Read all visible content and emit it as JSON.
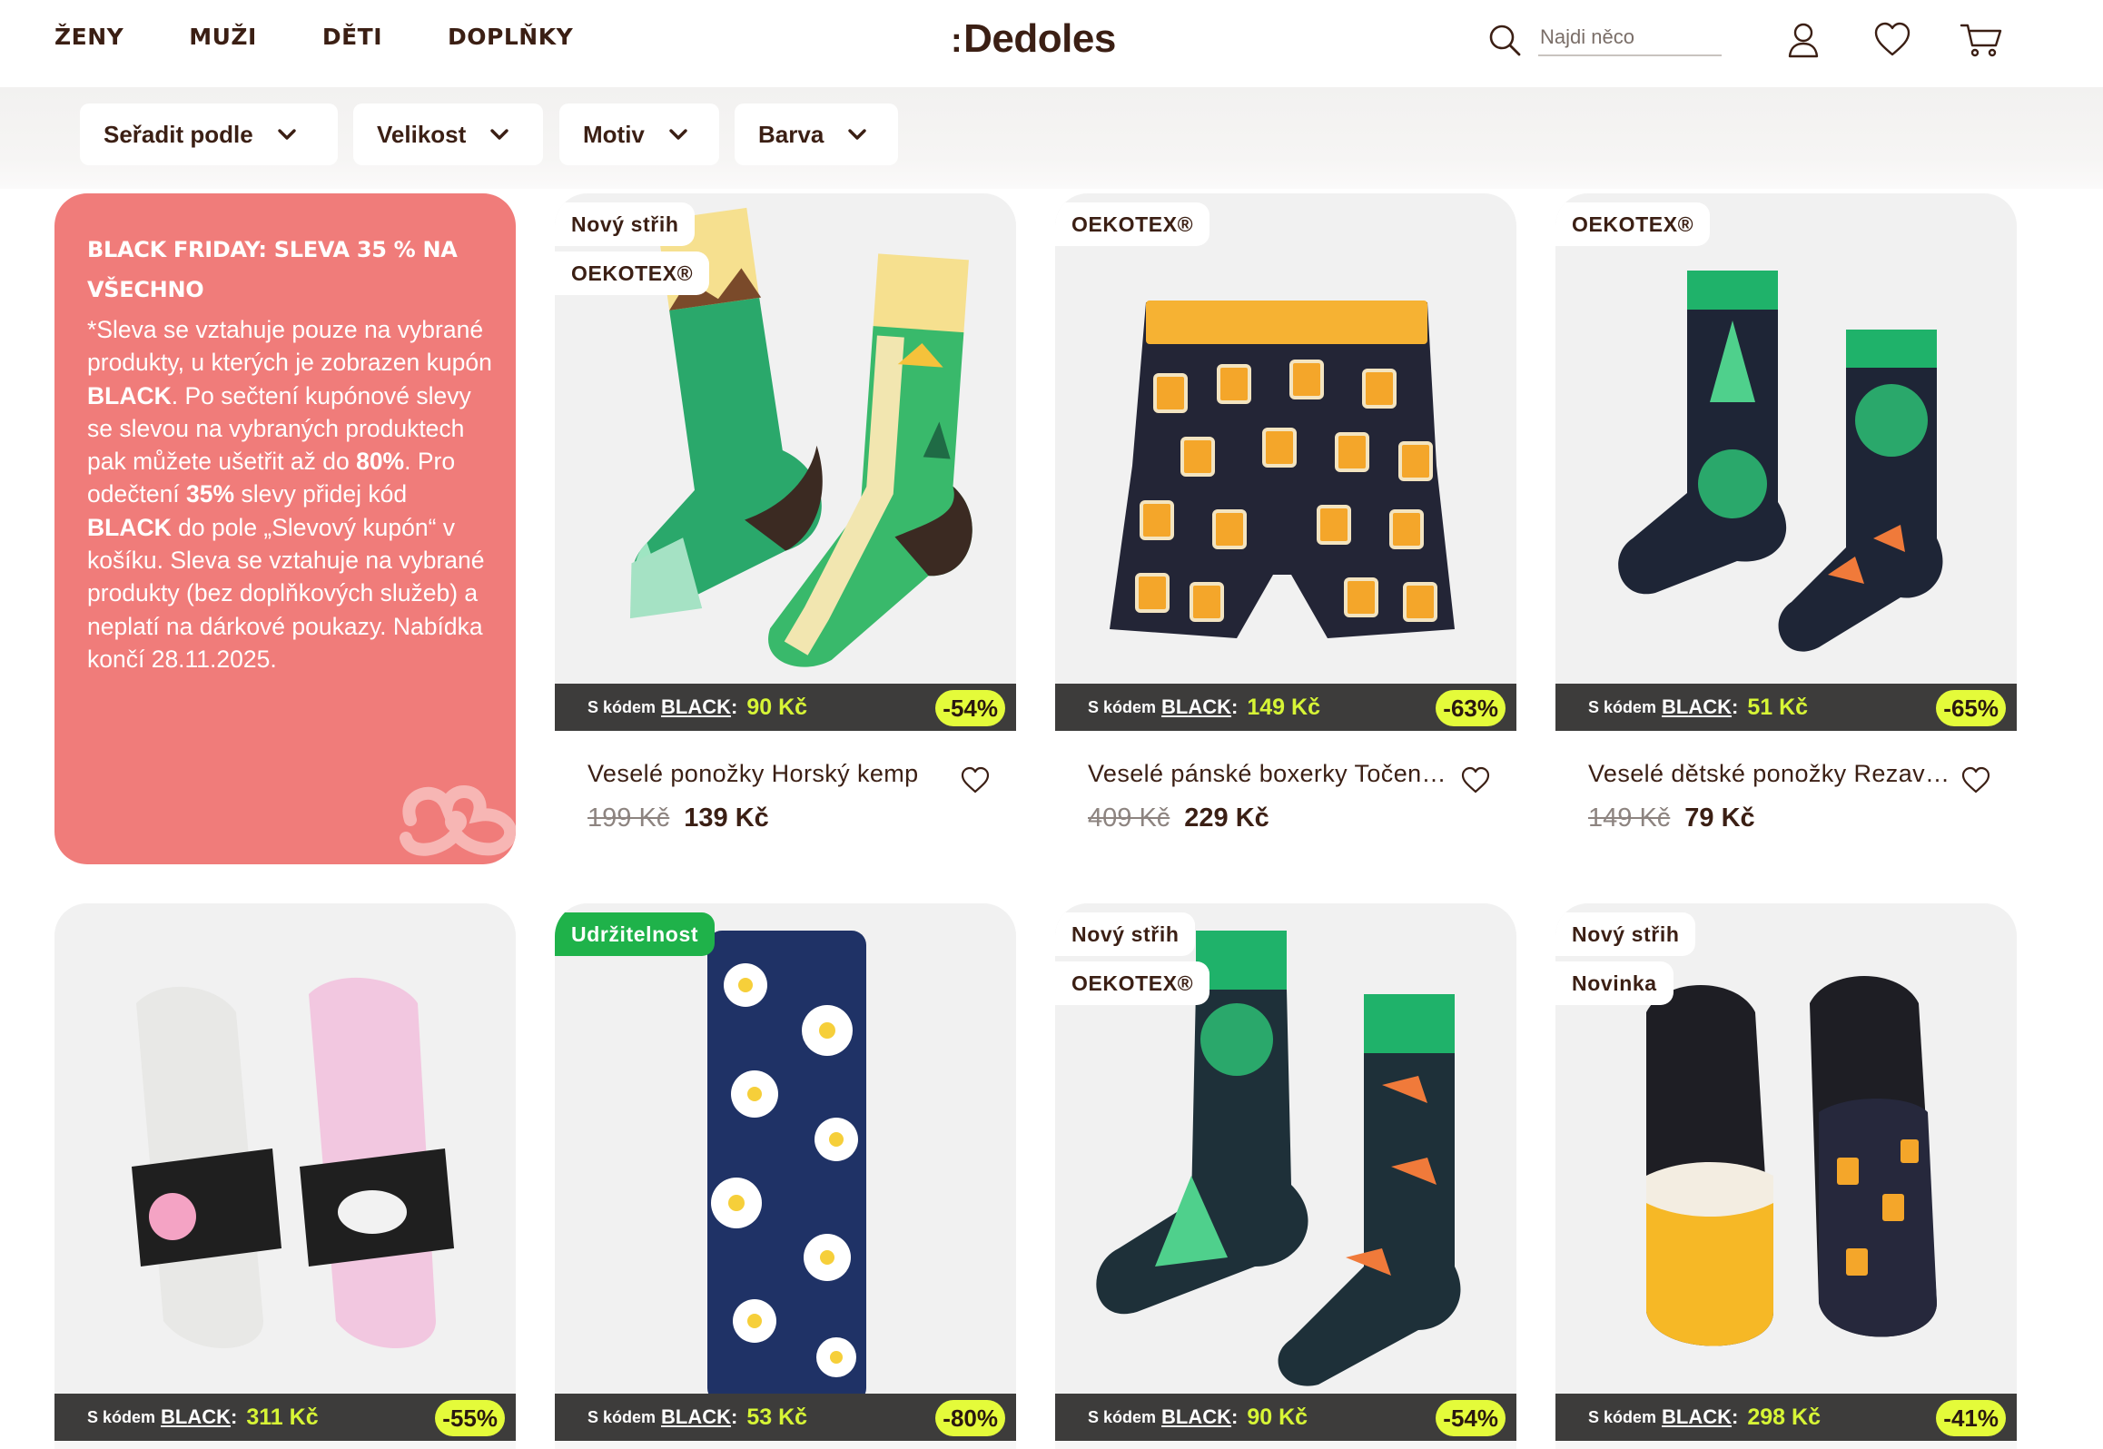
{
  "header": {
    "nav": [
      "ŽENY",
      "MUŽI",
      "DĚTI",
      "DOPLŇKY"
    ],
    "logo_prefix": ":",
    "logo_text": "Dedoles",
    "search_placeholder": "Najdi něco",
    "icons": [
      "search-icon",
      "user-icon",
      "heart-icon",
      "cart-icon"
    ]
  },
  "filters": [
    "Seřadit podle",
    "Velikost",
    "Motiv",
    "Barva"
  ],
  "promo": {
    "title": "Black Friday: sleva 35 % na všechno",
    "text_1": "*Sleva se vztahuje pouze na vybrané produkty, u kterých je zobrazen kupón ",
    "text_1_bold": "BLACK",
    "text_2": ". Po sečtení kupónové slevy se slevou na vybraných produktech pak můžete ušetřit až do ",
    "text_2_bold": "80%",
    "text_3": ". Pro odečtení ",
    "text_3_bold": "35%",
    "text_4": " slevy přidej kód ",
    "text_4_bold": "BLACK",
    "text_5": " do pole „Slevový kupón“ v košíku. Sleva se vztahuje na vybrané produkty (bez doplňkových služeb) a neplatí na dárkové poukazy. Nabídka končí 28.11.2025."
  },
  "code_label": "S kódem",
  "code_name": "BLACK",
  "code_colon": ":",
  "products": [
    {
      "badges": [
        "Nový střih",
        "OEKOTEX®"
      ],
      "code_price": "90 Kč",
      "discount": "-54%",
      "name": "Veselé ponožky Horský kemp",
      "old_price": "199 Kč",
      "price": "139 Kč"
    },
    {
      "badges": [
        "OEKOTEX®"
      ],
      "code_price": "149 Kč",
      "discount": "-63%",
      "name": "Veselé pánské boxerky Točené pivo",
      "old_price": "409 Kč",
      "price": "229 Kč"
    },
    {
      "badges": [
        "OEKOTEX®"
      ],
      "code_price": "51 Kč",
      "discount": "-65%",
      "name": "Veselé dětské ponožky Rezavá liška",
      "old_price": "149 Kč",
      "price": "79 Kč"
    },
    {
      "badges": [],
      "code_price": "311 Kč",
      "discount": "-55%"
    },
    {
      "badges": [
        "Udržitelnost"
      ],
      "code_price": "53 Kč",
      "discount": "-80%"
    },
    {
      "badges": [
        "Nový střih",
        "OEKOTEX®"
      ],
      "code_price": "90 Kč",
      "discount": "-54%"
    },
    {
      "badges": [
        "Nový střih",
        "Novinka"
      ],
      "code_price": "298 Kč",
      "discount": "-41%"
    }
  ],
  "colors": {
    "brand": "#3b1f14",
    "promo": "#f07c7a",
    "discount": "#e4fb3a",
    "code_price": "#d7f536",
    "sustain": "#1fb24a"
  }
}
